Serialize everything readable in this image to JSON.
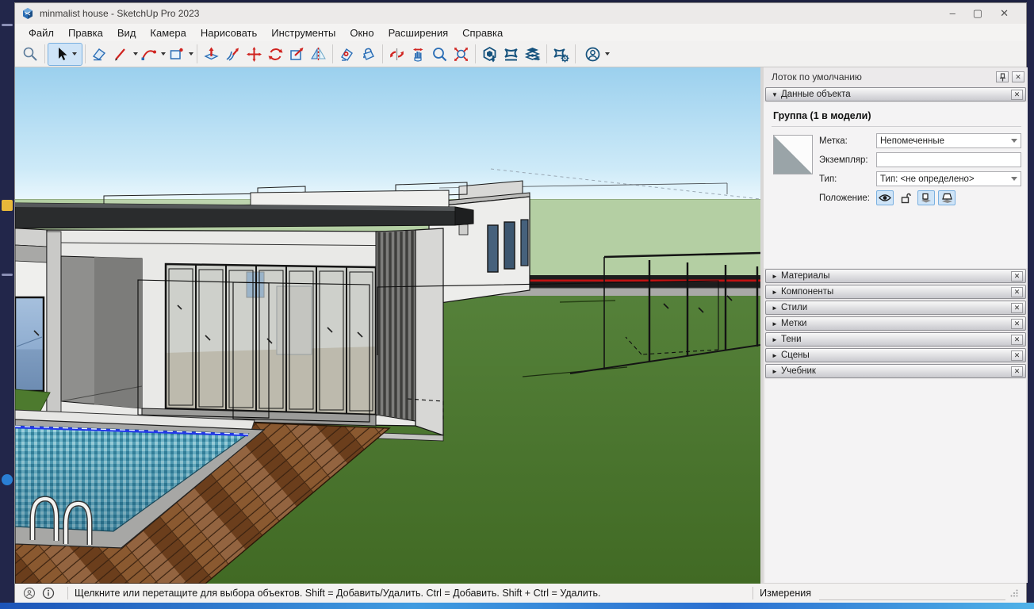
{
  "window": {
    "title": "minmalist house - SketchUp Pro 2023",
    "controls": {
      "minimize": "–",
      "maximize": "▢",
      "close": "✕"
    }
  },
  "menu": {
    "items": [
      "Файл",
      "Правка",
      "Вид",
      "Камера",
      "Нарисовать",
      "Инструменты",
      "Окно",
      "Расширения",
      "Справка"
    ]
  },
  "toolbar": {
    "tools": [
      "zoom-lens",
      "select",
      "eraser",
      "pencil-line",
      "two-point-arc",
      "rectangle",
      "push-pull",
      "follow-me",
      "move",
      "rotate",
      "scale",
      "flip",
      "tape-measure",
      "paint-bucket",
      "orbit",
      "pan",
      "zoom",
      "zoom-extents",
      "3d-warehouse",
      "extension-warehouse",
      "send-to-layout",
      "extension-manager",
      "account"
    ],
    "active_tool": "select"
  },
  "tray": {
    "title": "Лоток по умолчанию",
    "entity_info": {
      "header": "Данные объекта",
      "subtitle": "Группа (1 в модели)",
      "fields": {
        "label": {
          "name": "Метка:",
          "value": "Непомеченные"
        },
        "instance": {
          "name": "Экземпляр:",
          "value": ""
        },
        "type": {
          "name": "Тип:",
          "value": "Тип: <не определено>"
        },
        "position": {
          "name": "Положение:"
        }
      },
      "toggles": [
        "visible-eye",
        "unlock",
        "cast-shadows",
        "receive-shadows"
      ]
    },
    "sections": [
      {
        "label": "Материалы"
      },
      {
        "label": "Компоненты"
      },
      {
        "label": "Стили"
      },
      {
        "label": "Метки"
      },
      {
        "label": "Тени"
      },
      {
        "label": "Сцены"
      },
      {
        "label": "Учебник"
      }
    ],
    "section_arrow": "►",
    "expanded_arrow": "▼",
    "close_glyph": "✕"
  },
  "status_bar": {
    "hint": "Щелкните или перетащите для выбора объектов. Shift = Добавить/Удалить. Ctrl = Добавить. Shift + Ctrl = Удалить.",
    "measurements_label": "Измерения",
    "measurements_value": ""
  },
  "colors": {
    "selection_highlight": "#cfe4f7",
    "sketchup_red": "#d02420",
    "sketchup_blue": "#2a6db5",
    "axis_red_line": "#c21212",
    "sky": "#9ed2ef",
    "lawn_green": "#4a7a2e",
    "distant_ground": "#b4cfa3",
    "pool_water": "#55a3ba",
    "deck_wood": "#7a4a24"
  }
}
